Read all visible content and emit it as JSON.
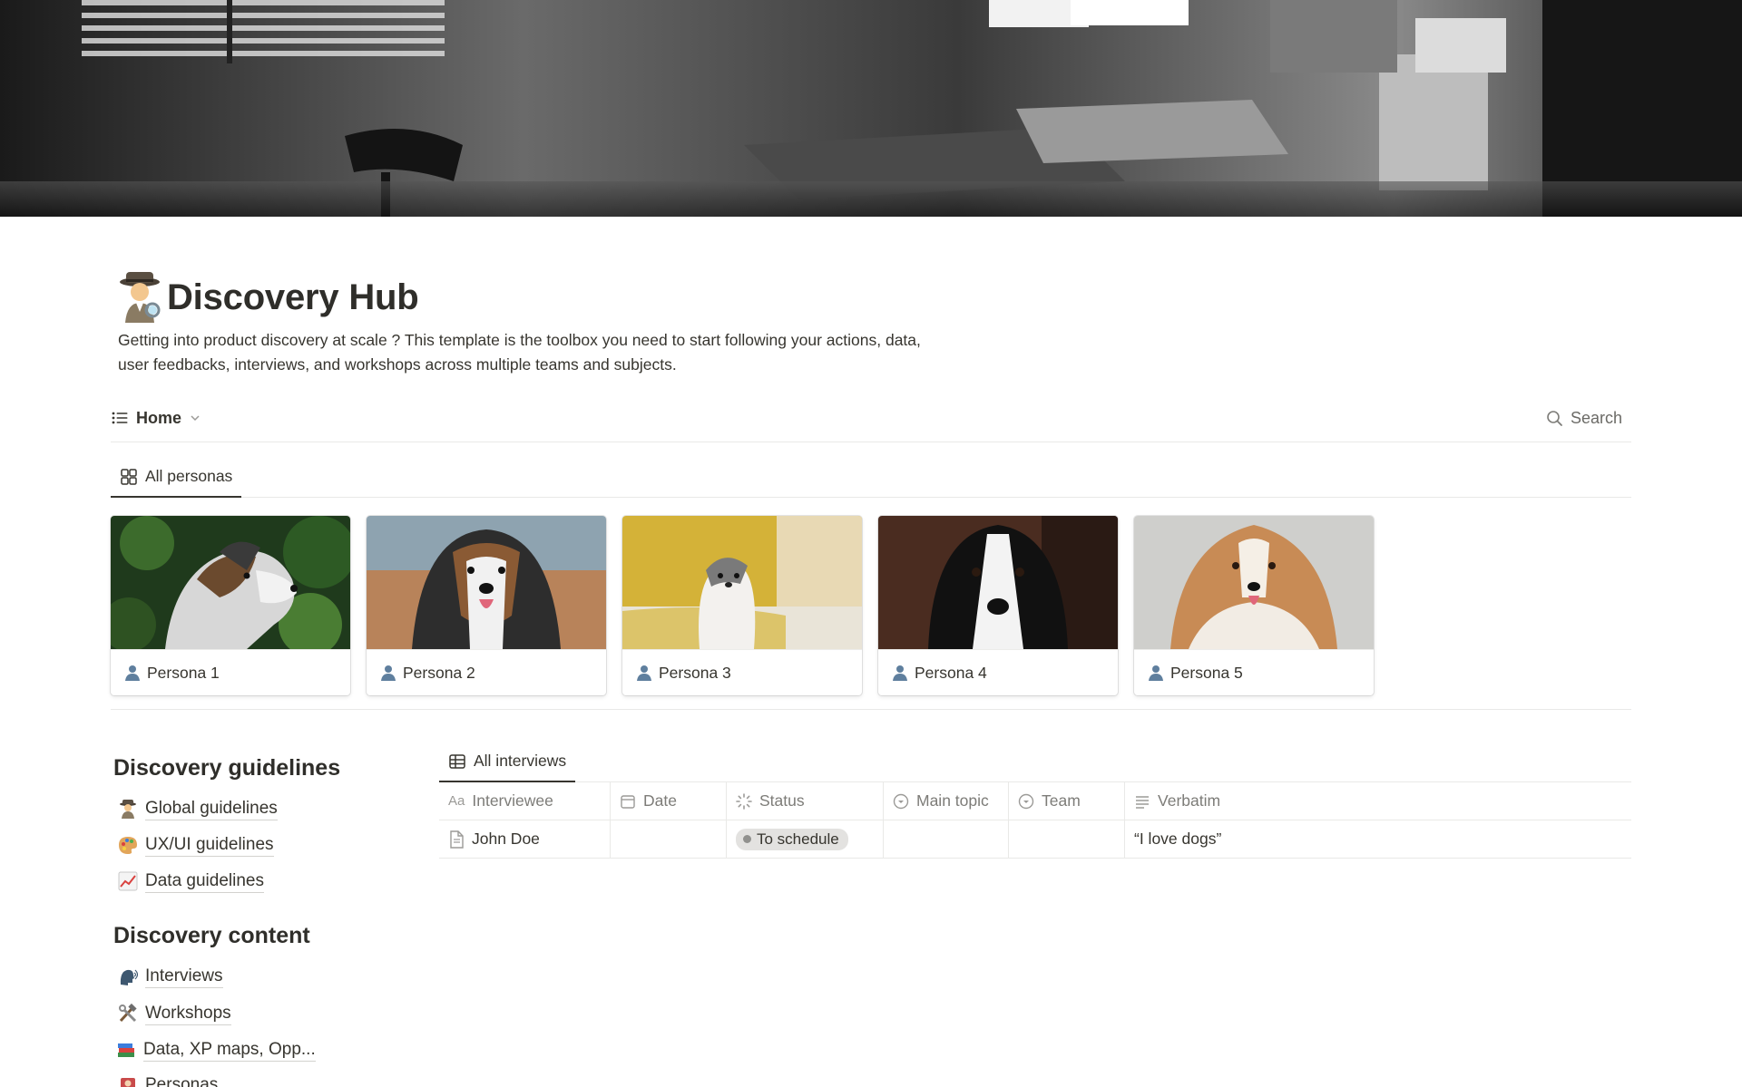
{
  "page": {
    "title": "Discovery Hub",
    "description_line1": "Getting into product discovery at scale ? This template is the toolbox you need to start following your actions, data,",
    "description_line2": "user feedbacks, interviews, and workshops across multiple teams and subjects."
  },
  "view_bar": {
    "view_label": "Home",
    "search_label": "Search"
  },
  "personas_tab": {
    "label": "All personas"
  },
  "personas": [
    {
      "label": "Persona 1"
    },
    {
      "label": "Persona 2"
    },
    {
      "label": "Persona 3"
    },
    {
      "label": "Persona 4"
    },
    {
      "label": "Persona 5"
    }
  ],
  "sidebar": {
    "guidelines_heading": "Discovery guidelines",
    "guidelines": [
      {
        "label": "Global guidelines",
        "icon": "detective-icon"
      },
      {
        "label": "UX/UI guidelines",
        "icon": "palette-icon"
      },
      {
        "label": "Data guidelines",
        "icon": "chart-increasing-icon"
      }
    ],
    "content_heading": "Discovery content",
    "content": [
      {
        "label": "Interviews",
        "icon": "speaking-head-icon"
      },
      {
        "label": "Workshops",
        "icon": "hammer-wrench-icon"
      },
      {
        "label": "Data, XP maps, Opp...",
        "icon": "books-icon"
      },
      {
        "label": "Personas",
        "icon": "person-icon"
      }
    ]
  },
  "interviews": {
    "tab_label": "All interviews",
    "columns": [
      {
        "label": "Interviewee",
        "icon": "text-aa-icon"
      },
      {
        "label": "Date",
        "icon": "calendar-icon"
      },
      {
        "label": "Status",
        "icon": "status-icon"
      },
      {
        "label": "Main topic",
        "icon": "select-icon"
      },
      {
        "label": "Team",
        "icon": "select-icon"
      },
      {
        "label": "Verbatim",
        "icon": "text-lines-icon"
      }
    ],
    "rows": [
      {
        "interviewee": "John Doe",
        "date": "",
        "status": "To schedule",
        "main_topic": "",
        "team": "",
        "verbatim": "“I love dogs”"
      }
    ]
  },
  "colors": {
    "accent_text": "#37352f",
    "muted": "#7d7c78",
    "pill_bg": "#e3e2e0",
    "divider": "#e9e9e7"
  }
}
